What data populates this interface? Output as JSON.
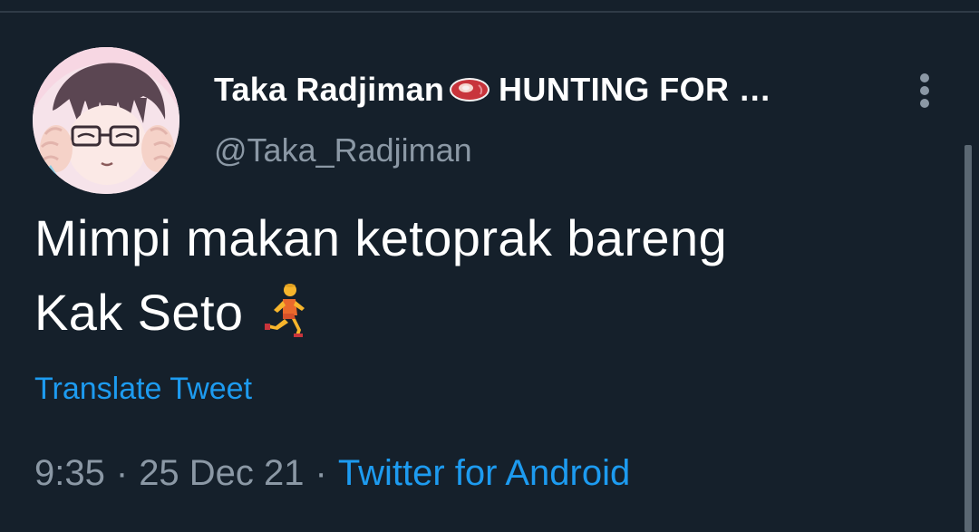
{
  "tweet": {
    "display_name": "Taka Radjiman",
    "display_name_suffix": "HUNTING FOR …",
    "handle": "@Taka_Radjiman",
    "text_line_1": "Mimpi makan ketoprak bareng",
    "text_line_2": "Kak Seto",
    "translate_label": "Translate Tweet",
    "time": "9:35",
    "separator": "·",
    "date": "25 Dec 21",
    "source": "Twitter for Android"
  },
  "icons": {
    "name_emoji": "meat-icon",
    "text_emoji": "person-running-icon",
    "menu": "more-vertical-icon",
    "avatar": "avatar-image"
  },
  "colors": {
    "background": "#15202b",
    "primary_text": "#ffffff",
    "secondary_text": "#8b98a5",
    "link": "#1d9bf0",
    "divider": "#2f3b47",
    "scrollbar": "#5b6873"
  }
}
